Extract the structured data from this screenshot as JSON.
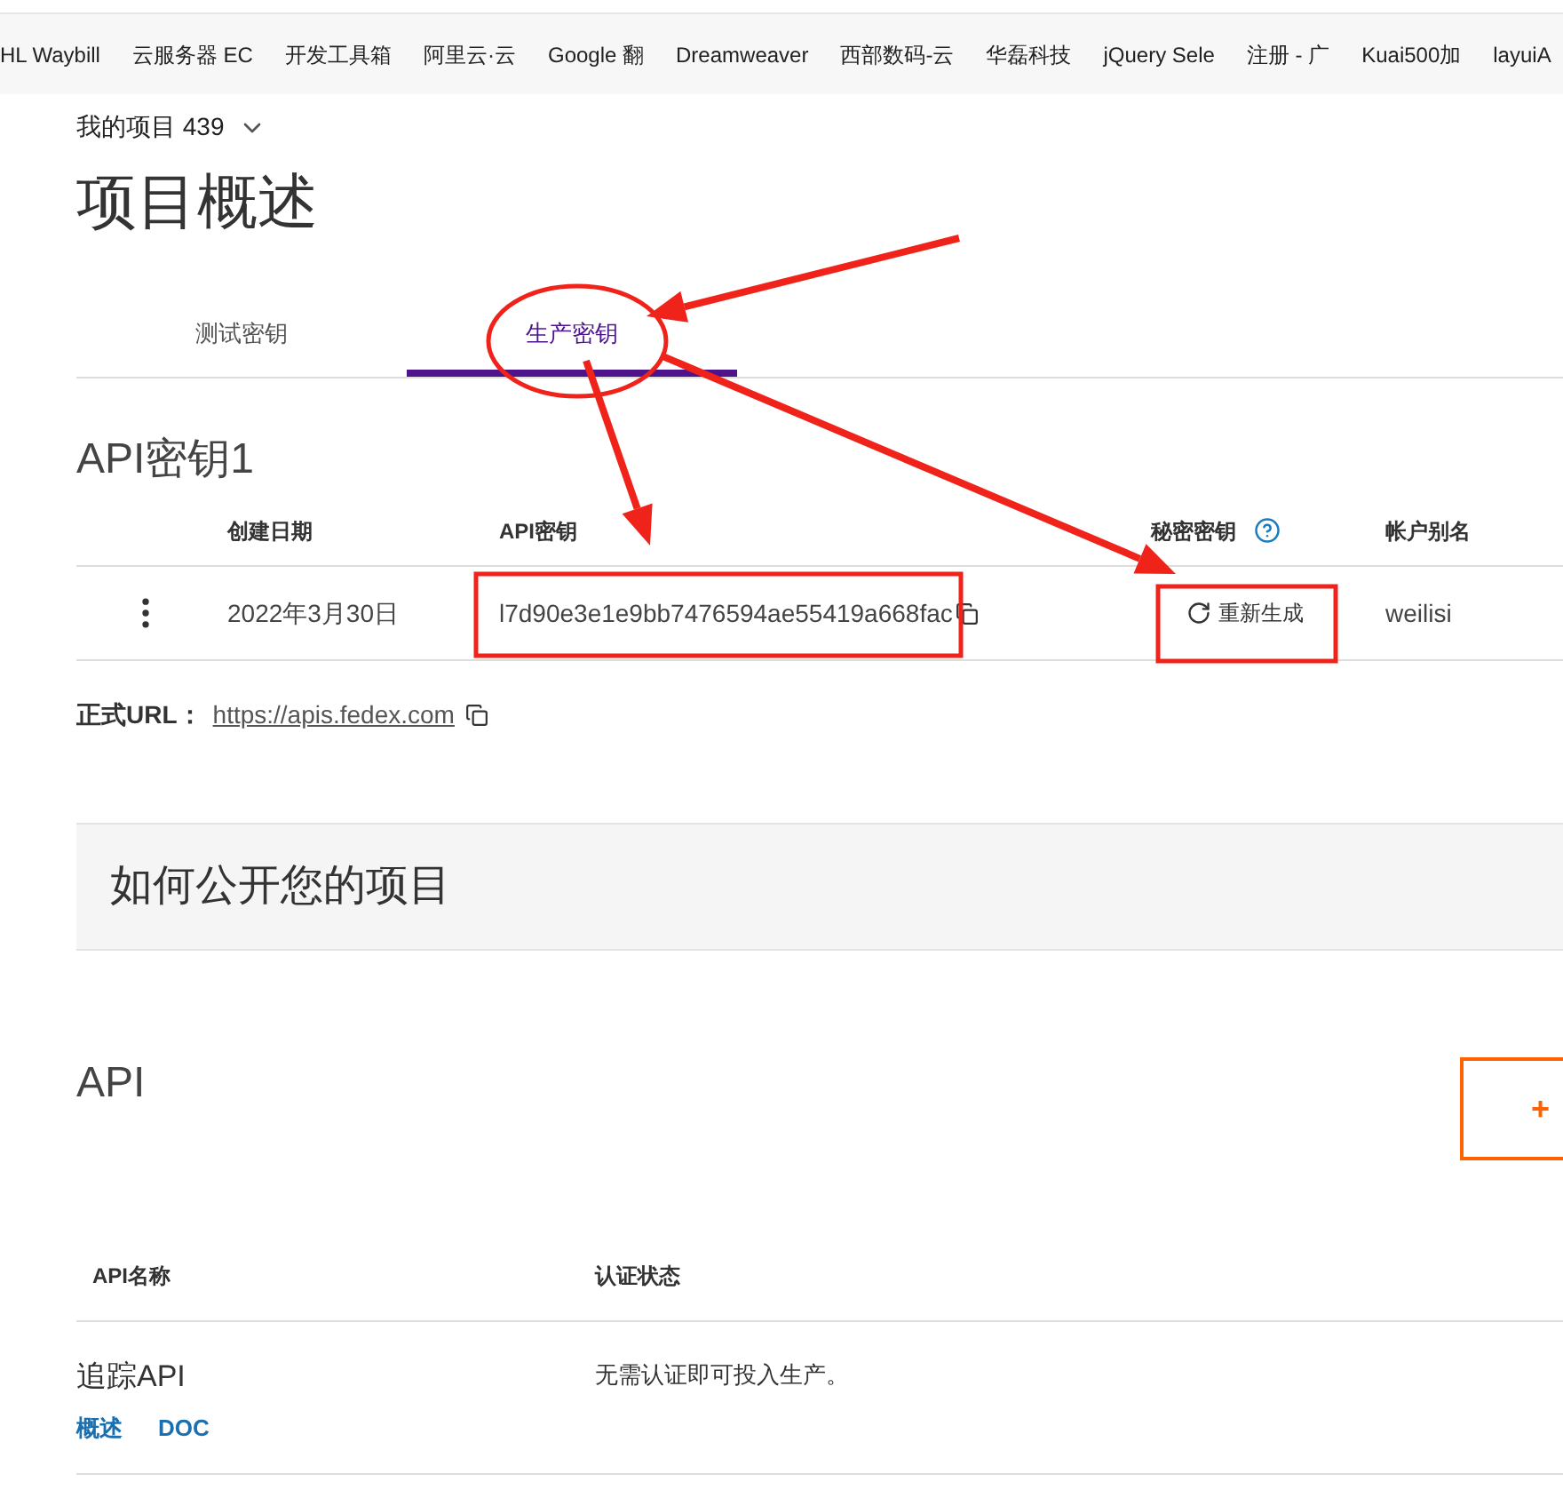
{
  "bookmarks": [
    "HL Waybill",
    "云服务器 EC",
    "开发工具箱",
    "阿里云·云",
    "Google 翻",
    "Dreamweaver",
    "西部数码-云",
    "华磊科技",
    "jQuery Sele",
    "注册 - 广",
    "Kuai500加",
    "layuiA"
  ],
  "project_selector": {
    "label": "我的项目 439"
  },
  "page_title": "项目概述",
  "tabs": [
    {
      "label": "测试密钥",
      "selected": false
    },
    {
      "label": "生产密钥",
      "selected": true
    }
  ],
  "key_section": {
    "title": "API密钥1",
    "columns": [
      "创建日期",
      "API密钥",
      "秘密密钥",
      "帐户别名"
    ],
    "rows": [
      {
        "date": "2022年3月30日",
        "key": "l7d90e3e1e9bb7476594ae55419a668fac",
        "action": "重新生成",
        "alias": "weilisi"
      }
    ],
    "url_label": "正式URL：",
    "url": "https://apis.fedex.com"
  },
  "publish_banner": "如何公开您的项目",
  "api_section": {
    "title": "API",
    "add_button": "+",
    "columns": [
      "API名称",
      "认证状态"
    ],
    "rows": [
      {
        "name": "追踪API",
        "status": "无需认证即可投入生产。",
        "links": [
          "概述",
          "DOC"
        ]
      }
    ]
  }
}
